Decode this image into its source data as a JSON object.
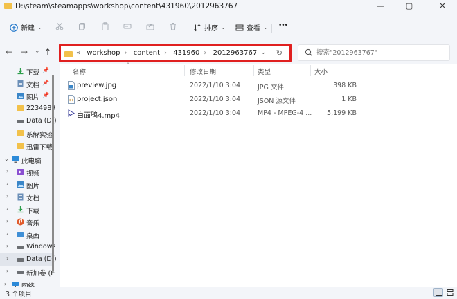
{
  "window": {
    "title": "D:\\steam\\steamapps\\workshop\\content\\431960\\2012963767",
    "minimize": "—",
    "maximize": "▢",
    "close": "✕"
  },
  "toolbar": {
    "new_label": "新建",
    "sort_label": "排序",
    "view_label": "查看",
    "more_label": "•••"
  },
  "nav": {
    "back": "←",
    "forward": "→",
    "down": "⌄",
    "up": "↑"
  },
  "address": {
    "overflow": "«",
    "crumbs": [
      "workshop",
      "content",
      "431960",
      "2012963767"
    ],
    "dropdown": "⌄",
    "refresh": "↻"
  },
  "search": {
    "placeholder": "搜索\"2012963767\""
  },
  "sidebar": {
    "items": [
      {
        "label": "下载",
        "pinned": true
      },
      {
        "label": "文档",
        "pinned": true
      },
      {
        "label": "图片",
        "pinned": true
      },
      {
        "label": "2234989"
      },
      {
        "label": "Data (D:)"
      },
      {
        "label": "系解实验"
      },
      {
        "label": "迅雷下载"
      },
      {
        "label": "此电脑"
      },
      {
        "label": "视频"
      },
      {
        "label": "图片"
      },
      {
        "label": "文档"
      },
      {
        "label": "下载"
      },
      {
        "label": "音乐"
      },
      {
        "label": "桌面"
      },
      {
        "label": "Windows"
      },
      {
        "label": "Data (D:)"
      },
      {
        "label": "新加卷 (E"
      },
      {
        "label": "网络"
      }
    ]
  },
  "columns": {
    "name": "名称",
    "date": "修改日期",
    "type": "类型",
    "size": "大小"
  },
  "files": [
    {
      "name": "preview.jpg",
      "date": "2022/1/10 3:04",
      "type": "JPG 文件",
      "size": "398 KB",
      "icon": "image-file-icon"
    },
    {
      "name": "project.json",
      "date": "2022/1/10 3:04",
      "type": "JSON 源文件",
      "size": "1 KB",
      "icon": "json-file-icon"
    },
    {
      "name": "白面鸮4.mp4",
      "date": "2022/1/10 3:04",
      "type": "MP4 - MPEG-4 ...",
      "size": "5,199 KB",
      "icon": "video-file-icon"
    }
  ],
  "status": {
    "count": "3 个项目"
  },
  "colors": {
    "highlight": "#e02020",
    "folder": "#f2c14b",
    "accent": "#1a73c9"
  }
}
